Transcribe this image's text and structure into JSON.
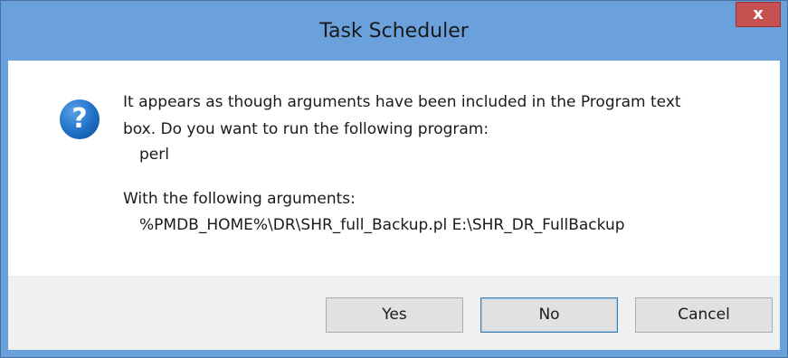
{
  "window": {
    "title": "Task Scheduler",
    "close_glyph": "x"
  },
  "message": {
    "icon": "question-icon",
    "line1": "It appears as though arguments have been included in the Program text",
    "line2": "box. Do you want to run the following program:",
    "program": "perl",
    "args_label": "With the following arguments:",
    "arguments": "%PMDB_HOME%\\DR\\SHR_full_Backup.pl E:\\SHR_DR_FullBackup"
  },
  "buttons": {
    "yes": "Yes",
    "no": "No",
    "cancel": "Cancel"
  },
  "colors": {
    "titlebar": "#6aa1dc",
    "close": "#c75050",
    "icon": "#1d6fc6"
  }
}
